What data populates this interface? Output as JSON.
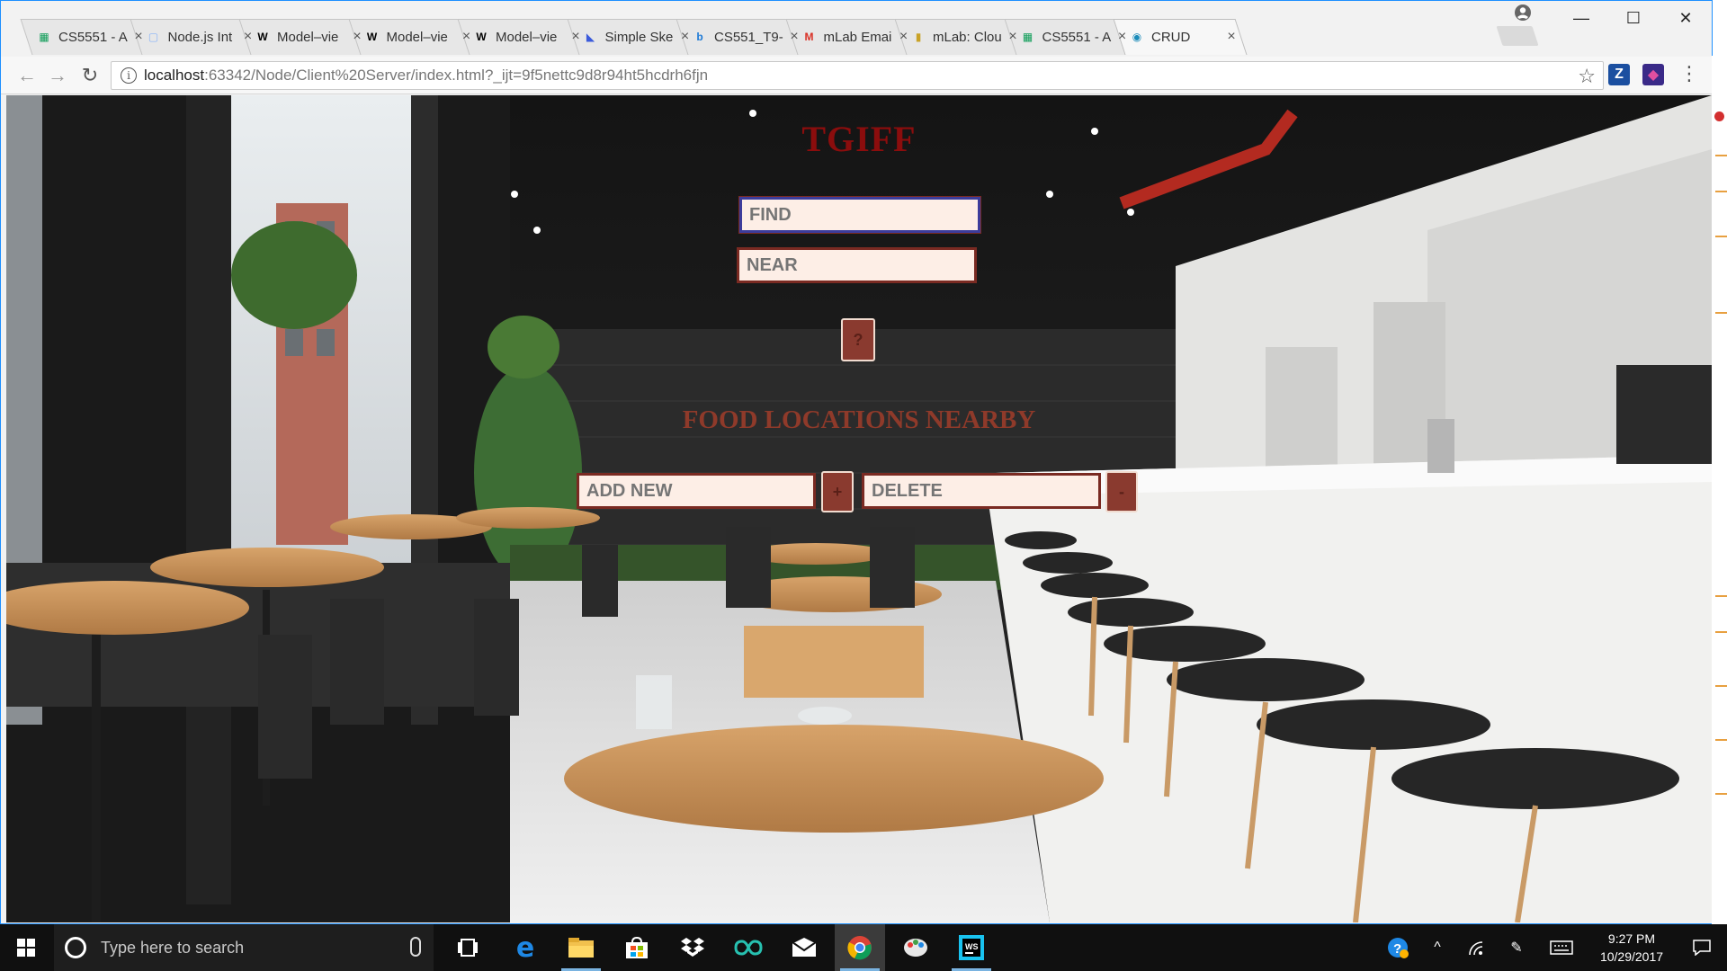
{
  "browser": {
    "tabs": [
      {
        "title": "CS5551 - A",
        "favicon": "sheets-icon",
        "color": "#0f9d58"
      },
      {
        "title": "Node.js Int",
        "favicon": "page-icon",
        "color": "#8ab4f8"
      },
      {
        "title": "Model–vie",
        "favicon": "wikipedia-icon",
        "color": "#000000"
      },
      {
        "title": "Model–vie",
        "favicon": "wikipedia-icon",
        "color": "#000000"
      },
      {
        "title": "Model–vie",
        "favicon": "wikipedia-icon",
        "color": "#000000"
      },
      {
        "title": "Simple Ske",
        "favicon": "chart-icon",
        "color": "#3b5bdb"
      },
      {
        "title": "CS551_T9-",
        "favicon": "box-icon",
        "color": "#1e7ad6"
      },
      {
        "title": "mLab Emai",
        "favicon": "gmail-icon",
        "color": "#d93025"
      },
      {
        "title": "mLab: Clou",
        "favicon": "mlab-icon",
        "color": "#c9a227"
      },
      {
        "title": "CS5551 - A",
        "favicon": "sheets-icon",
        "color": "#0f9d58"
      },
      {
        "title": "CRUD",
        "favicon": "crud-icon",
        "color": "#1a8bb9",
        "active": true
      }
    ],
    "url_host": "localhost",
    "url_rest": ":63342/Node/Client%20Server/index.html?_ijt=9f5nettc9d8r94ht5hcdrh6fjn",
    "extensions": [
      {
        "name": "zotero-icon",
        "glyph": "Z",
        "color": "#1b4fa0"
      },
      {
        "name": "extension-icon",
        "glyph": "◆",
        "color": "#3a2a88"
      }
    ]
  },
  "page": {
    "title": "TGIFF",
    "find_placeholder": "FIND",
    "near_placeholder": "NEAR",
    "search_button": "?",
    "section_title": "FOOD LOCATIONS NEARBY",
    "add_placeholder": "ADD NEW",
    "add_button": "+",
    "delete_placeholder": "DELETE",
    "delete_button": "-"
  },
  "taskbar": {
    "search_placeholder": "Type here to search",
    "time": "9:27 PM",
    "date": "10/29/2017"
  },
  "colors": {
    "title": "#8b0d0d",
    "section_title": "#8f3a2a",
    "input_bg": "#fdeee6",
    "input_border": "#7a2a22",
    "button_bg": "#8a3a2f"
  }
}
